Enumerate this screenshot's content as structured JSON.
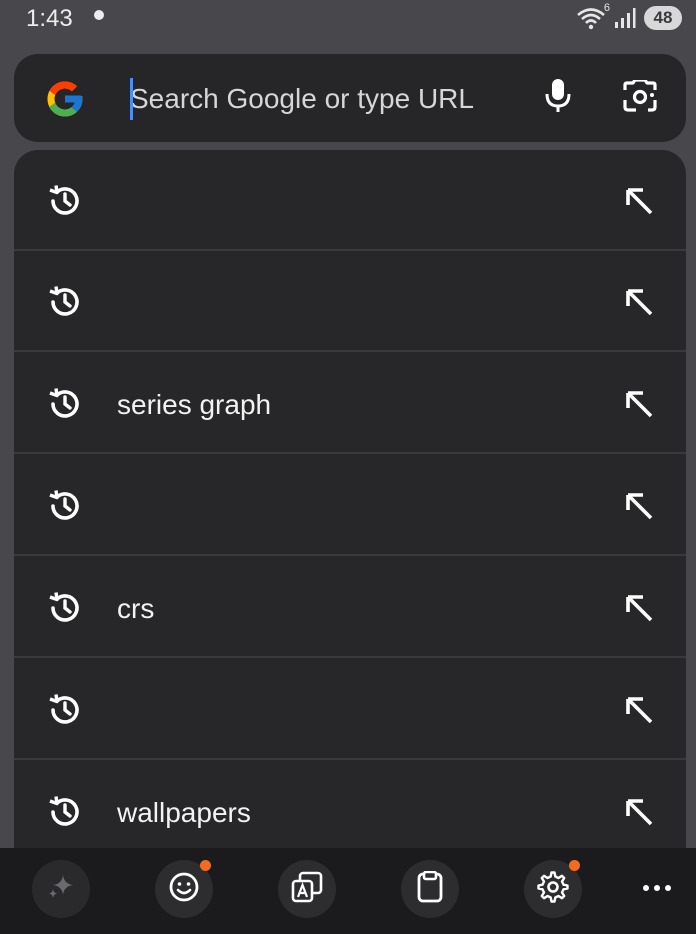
{
  "status_bar": {
    "time": "1:43",
    "wifi_label": "6",
    "battery": "48"
  },
  "search": {
    "placeholder": "Search Google or type URL",
    "value": ""
  },
  "suggestions": [
    {
      "text": "",
      "icon": "history-icon",
      "action_icon": "fill-query-arrow-icon"
    },
    {
      "text": "",
      "icon": "history-icon",
      "action_icon": "fill-query-arrow-icon"
    },
    {
      "text": "series graph",
      "icon": "history-icon",
      "action_icon": "fill-query-arrow-icon"
    },
    {
      "text": "",
      "icon": "history-icon",
      "action_icon": "fill-query-arrow-icon"
    },
    {
      "text": "crs",
      "icon": "history-icon",
      "action_icon": "fill-query-arrow-icon"
    },
    {
      "text": "",
      "icon": "history-icon",
      "action_icon": "fill-query-arrow-icon"
    },
    {
      "text": "wallpapers",
      "icon": "history-icon",
      "action_icon": "fill-query-arrow-icon"
    }
  ],
  "keyboard_toolbar": {
    "items": [
      {
        "icon": "ai-sparkle-icon",
        "badge": false
      },
      {
        "icon": "emoji-icon",
        "badge": true
      },
      {
        "icon": "translate-icon",
        "badge": false
      },
      {
        "icon": "clipboard-icon",
        "badge": false
      },
      {
        "icon": "settings-gear-icon",
        "badge": true
      },
      {
        "icon": "more-icon",
        "badge": false
      }
    ]
  },
  "colors": {
    "background": "#48484c",
    "surface": "#272729",
    "search_surface": "#262628",
    "caret": "#4f8df5",
    "badge": "#f26b21",
    "keyboard_bar": "#1b1b1d"
  }
}
